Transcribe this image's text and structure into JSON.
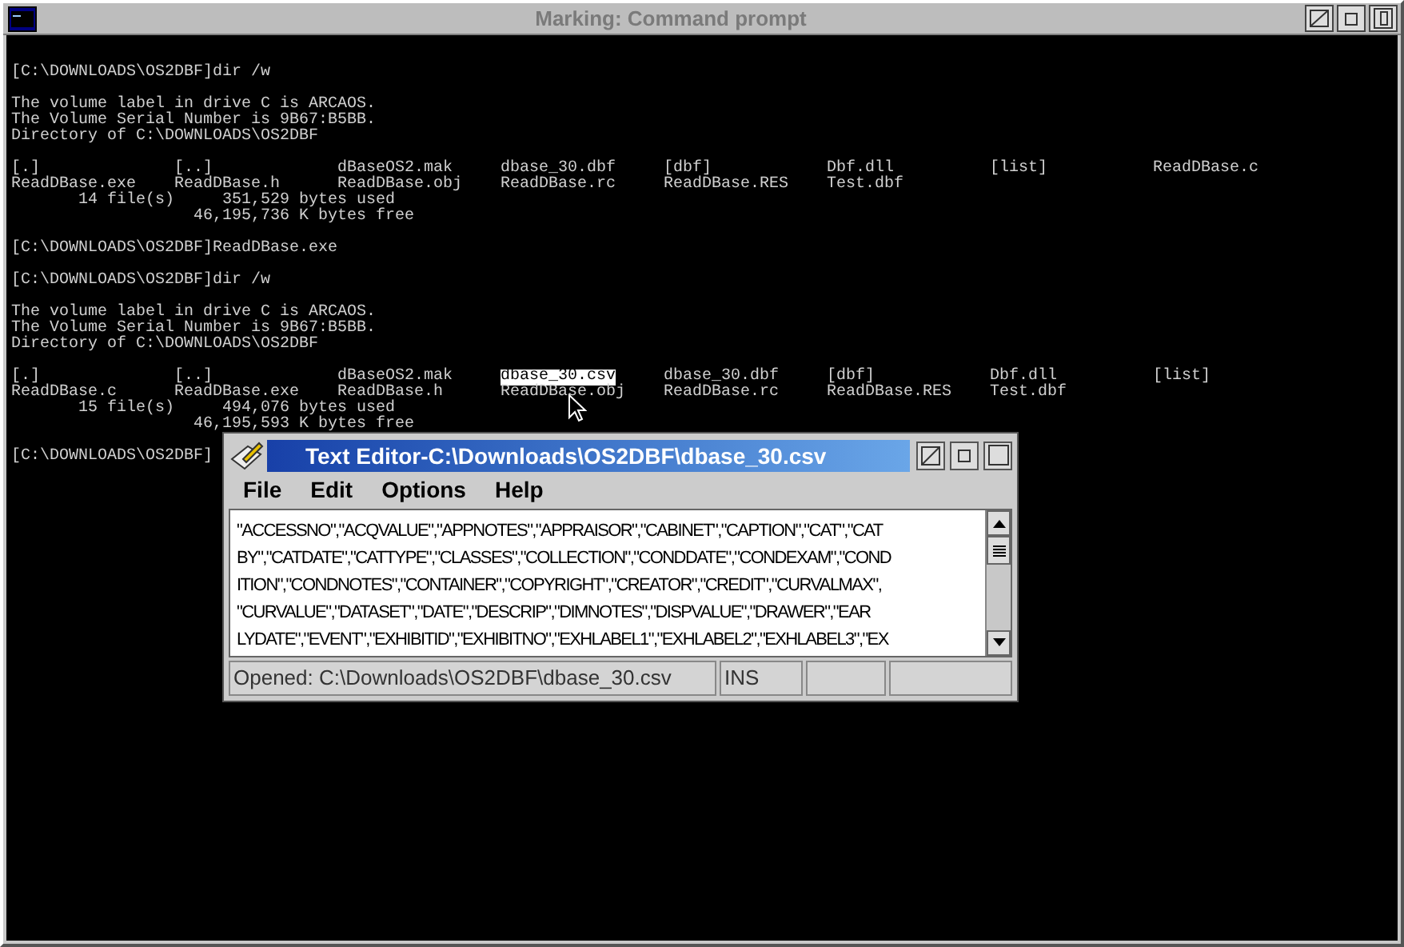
{
  "console": {
    "title": "Marking: Command prompt",
    "lines": [
      {
        "kind": "text",
        "text": "[C:\\DOWNLOADS\\OS2DBF]dir /w"
      },
      {
        "kind": "blank"
      },
      {
        "kind": "text",
        "text": "The volume label in drive C is ARCAOS."
      },
      {
        "kind": "text",
        "text": "The Volume Serial Number is 9B67:B5BB."
      },
      {
        "kind": "text",
        "text": "Directory of C:\\DOWNLOADS\\OS2DBF"
      },
      {
        "kind": "blank"
      },
      {
        "kind": "files",
        "cells": [
          {
            "text": "[.]",
            "selected": false
          },
          {
            "text": "[..]",
            "selected": false
          },
          {
            "text": "dBaseOS2.mak",
            "selected": false
          },
          {
            "text": "dbase_30.dbf",
            "selected": false
          },
          {
            "text": "[dbf]",
            "selected": false
          },
          {
            "text": "Dbf.dll",
            "selected": false
          },
          {
            "text": "[list]",
            "selected": false
          },
          {
            "text": "ReadDBase.c",
            "selected": false
          }
        ]
      },
      {
        "kind": "files",
        "cells": [
          {
            "text": "ReadDBase.exe",
            "selected": false
          },
          {
            "text": "ReadDBase.h",
            "selected": false
          },
          {
            "text": "ReadDBase.obj",
            "selected": false
          },
          {
            "text": "ReadDBase.rc",
            "selected": false
          },
          {
            "text": "ReadDBase.RES",
            "selected": false
          },
          {
            "text": "Test.dbf",
            "selected": false
          }
        ]
      },
      {
        "kind": "summary",
        "count": "14 file(s)",
        "used": "351,529 bytes used"
      },
      {
        "kind": "free",
        "text": "46,195,736 K bytes free"
      },
      {
        "kind": "blank"
      },
      {
        "kind": "text",
        "text": "[C:\\DOWNLOADS\\OS2DBF]ReadDBase.exe"
      },
      {
        "kind": "blank"
      },
      {
        "kind": "text",
        "text": "[C:\\DOWNLOADS\\OS2DBF]dir /w"
      },
      {
        "kind": "blank"
      },
      {
        "kind": "text",
        "text": "The volume label in drive C is ARCAOS."
      },
      {
        "kind": "text",
        "text": "The Volume Serial Number is 9B67:B5BB."
      },
      {
        "kind": "text",
        "text": "Directory of C:\\DOWNLOADS\\OS2DBF"
      },
      {
        "kind": "blank"
      },
      {
        "kind": "files",
        "cells": [
          {
            "text": "[.]",
            "selected": false
          },
          {
            "text": "[..]",
            "selected": false
          },
          {
            "text": "dBaseOS2.mak",
            "selected": false
          },
          {
            "text": "dbase_30.csv",
            "selected": true
          },
          {
            "text": "dbase_30.dbf",
            "selected": false
          },
          {
            "text": "[dbf]",
            "selected": false
          },
          {
            "text": "Dbf.dll",
            "selected": false
          },
          {
            "text": "[list]",
            "selected": false
          }
        ]
      },
      {
        "kind": "files",
        "cells": [
          {
            "text": "ReadDBase.c",
            "selected": false
          },
          {
            "text": "ReadDBase.exe",
            "selected": false
          },
          {
            "text": "ReadDBase.h",
            "selected": false
          },
          {
            "text": "ReadDBase.obj",
            "selected": false
          },
          {
            "text": "ReadDBase.rc",
            "selected": false
          },
          {
            "text": "ReadDBase.RES",
            "selected": false
          },
          {
            "text": "Test.dbf",
            "selected": false
          }
        ]
      },
      {
        "kind": "summary",
        "count": "15 file(s)",
        "used": "494,076 bytes used"
      },
      {
        "kind": "free",
        "text": "46,195,593 K bytes free"
      },
      {
        "kind": "blank"
      },
      {
        "kind": "text",
        "text": "[C:\\DOWNLOADS\\OS2DBF]"
      }
    ]
  },
  "editor": {
    "title": "Text Editor-C:\\Downloads\\OS2DBF\\dbase_30.csv",
    "menu": [
      {
        "label": "File"
      },
      {
        "label": "Edit"
      },
      {
        "label": "Options"
      },
      {
        "label": "Help"
      }
    ],
    "lines": [
      "\"ACCESSNO\",\"ACQVALUE\",\"APPNOTES\",\"APPRAISOR\",\"CABINET\",\"CAPTION\",\"CAT\",\"CAT",
      "BY\",\"CATDATE\",\"CATTYPE\",\"CLASSES\",\"COLLECTION\",\"CONDDATE\",\"CONDEXAM\",\"COND",
      "ITION\",\"CONDNOTES\",\"CONTAINER\",\"COPYRIGHT\",\"CREATOR\",\"CREDIT\",\"CURVALMAX\",",
      "\"CURVALUE\",\"DATASET\",\"DATE\",\"DESCRIP\",\"DIMNOTES\",\"DISPVALUE\",\"DRAWER\",\"EAR",
      "LYDATE\",\"EVENT\",\"EXHIBITID\",\"EXHIBITNO\",\"EXHLABEL1\",\"EXHLABEL2\",\"EXHLABEL3\",\"EX"
    ],
    "status": "Opened: C:\\Downloads\\OS2DBF\\dbase_30.csv",
    "mode": "INS"
  }
}
